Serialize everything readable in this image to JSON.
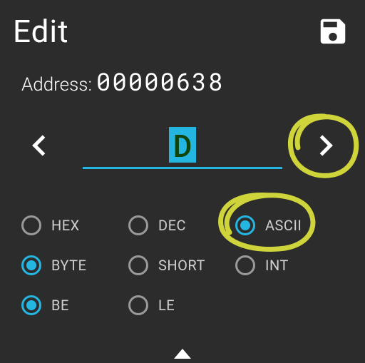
{
  "header": {
    "title": "Edit"
  },
  "address": {
    "label": "Address:",
    "value": "00000638"
  },
  "editor": {
    "value": "D"
  },
  "radios": {
    "format": {
      "hex": "HEX",
      "dec": "DEC",
      "ascii": "ASCII",
      "selected": "ascii"
    },
    "size": {
      "byte": "BYTE",
      "short": "SHORT",
      "int": "INT",
      "selected": "byte"
    },
    "endian": {
      "be": "BE",
      "le": "LE",
      "selected": "be"
    }
  },
  "colors": {
    "accent": "#24b6e0",
    "annotation": "#cfd43a"
  }
}
